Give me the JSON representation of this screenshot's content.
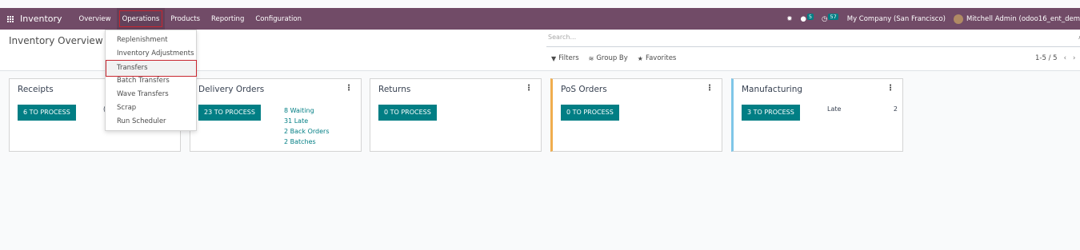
{
  "navbar": {
    "brand": "Inventory",
    "menu": [
      "Overview",
      "Operations",
      "Products",
      "Reporting",
      "Configuration"
    ],
    "systray": {
      "messages_count": "5",
      "activities_count": "57",
      "company": "My Company (San Francisco)",
      "user": "Mitchell Admin (odoo16_ent_dem"
    }
  },
  "control_panel": {
    "title": "Inventory Overview",
    "search_placeholder": "Search...",
    "filters_label": "Filters",
    "groupby_label": "Group By",
    "favorites_label": "Favorites",
    "pager": "1-5 / 5"
  },
  "operations_menu": {
    "items": [
      "Replenishment",
      "Inventory Adjustments",
      "Transfers",
      "Batch Transfers",
      "Wave Transfers",
      "Scrap",
      "Run Scheduler"
    ],
    "highlighted": "Transfers"
  },
  "cards": [
    {
      "title": "Receipts",
      "button": "6 TO PROCESS",
      "extra": "("
    },
    {
      "title": "Delivery Orders",
      "button": "23 TO PROCESS",
      "stats": [
        "8 Waiting",
        "31 Late",
        "2 Back Orders",
        "2 Batches"
      ]
    },
    {
      "title": "Returns",
      "button": "0 TO PROCESS"
    },
    {
      "title": "PoS Orders",
      "button": "0 TO PROCESS"
    },
    {
      "title": "Manufacturing",
      "button": "3 TO PROCESS",
      "late_label": "Late",
      "late_value": "2"
    }
  ],
  "colors": {
    "navbar": "#714b67",
    "primary_button": "#017e84",
    "highlight_outline": "#c8262f",
    "pos_accent": "#f0ad4e",
    "mfg_accent": "#7fc6e8"
  }
}
